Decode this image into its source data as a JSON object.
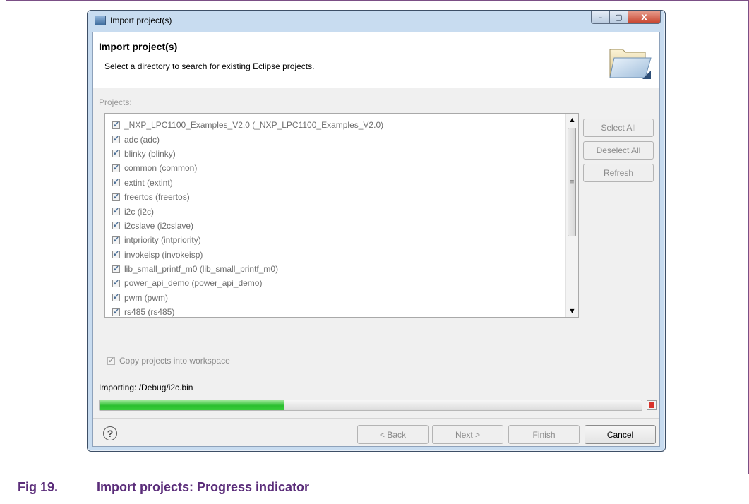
{
  "window": {
    "title": "Import project(s)",
    "buttons": {
      "minimize": "–",
      "maximize": "▢",
      "close": "x"
    }
  },
  "header": {
    "title": "Import project(s)",
    "description": "Select a directory to search for existing Eclipse projects."
  },
  "projects": {
    "label": "Projects:",
    "items": [
      {
        "label": "_NXP_LPC1100_Examples_V2.0 (_NXP_LPC1100_Examples_V2.0)",
        "checked": true
      },
      {
        "label": "adc (adc)",
        "checked": true
      },
      {
        "label": "blinky (blinky)",
        "checked": true
      },
      {
        "label": "common (common)",
        "checked": true
      },
      {
        "label": "extint (extint)",
        "checked": true
      },
      {
        "label": "freertos (freertos)",
        "checked": true
      },
      {
        "label": "i2c (i2c)",
        "checked": true
      },
      {
        "label": "i2cslave (i2cslave)",
        "checked": true
      },
      {
        "label": "intpriority (intpriority)",
        "checked": true
      },
      {
        "label": "invokeisp (invokeisp)",
        "checked": true
      },
      {
        "label": "lib_small_printf_m0 (lib_small_printf_m0)",
        "checked": true
      },
      {
        "label": "power_api_demo (power_api_demo)",
        "checked": true
      },
      {
        "label": "pwm (pwm)",
        "checked": true
      },
      {
        "label": "rs485 (rs485)",
        "checked": true
      }
    ],
    "scroll": {
      "up": "▲",
      "down": "▼",
      "grip": "≡"
    }
  },
  "side_buttons": {
    "select_all": "Select All",
    "deselect_all": "Deselect All",
    "refresh": "Refresh"
  },
  "copy_option": {
    "label": "Copy projects into workspace",
    "checked": true
  },
  "progress": {
    "status": "Importing: /Debug/i2c.bin",
    "fraction": 0.34
  },
  "footer": {
    "help": "?",
    "back": "< Back",
    "next": "Next >",
    "finish": "Finish",
    "cancel": "Cancel"
  },
  "caption": {
    "number": "Fig 19.",
    "text": "Import projects: Progress indicator"
  },
  "colors": {
    "caption": "#5b2d7a",
    "progress": "#2bbf2f",
    "stop": "#d9322b"
  }
}
